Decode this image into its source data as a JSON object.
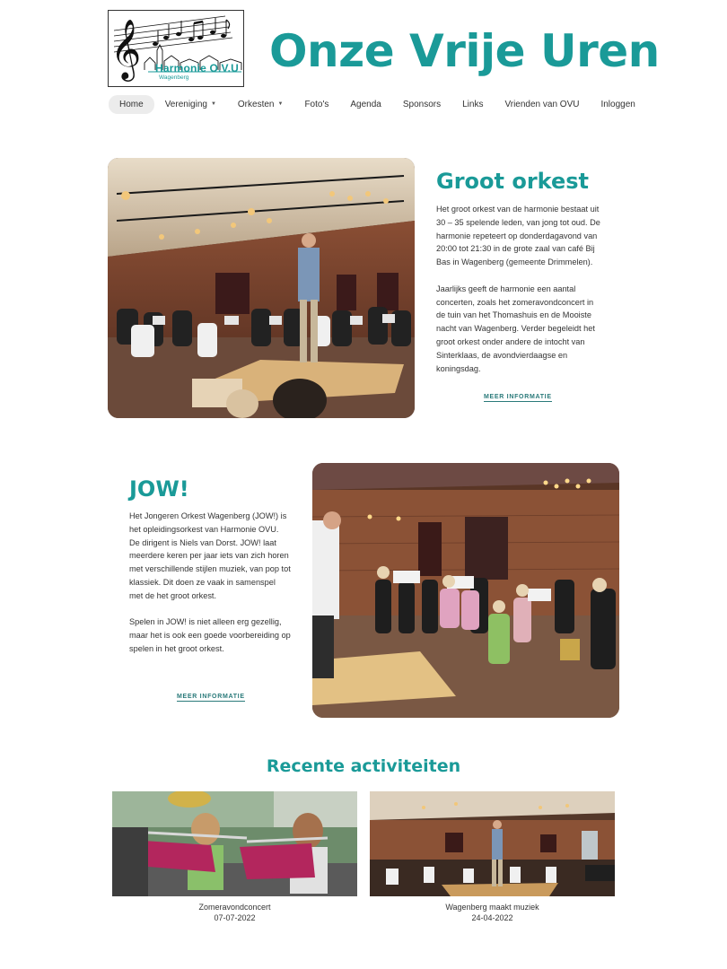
{
  "header": {
    "logo_title": "Harmonie O.V.U",
    "logo_subtitle": "Wagenberg",
    "site_title": "Onze Vrije Uren"
  },
  "nav": {
    "items": [
      {
        "label": "Home",
        "active": true,
        "has_dropdown": false
      },
      {
        "label": "Vereniging",
        "active": false,
        "has_dropdown": true
      },
      {
        "label": "Orkesten",
        "active": false,
        "has_dropdown": true
      },
      {
        "label": "Foto's",
        "active": false,
        "has_dropdown": false
      },
      {
        "label": "Agenda",
        "active": false,
        "has_dropdown": false
      },
      {
        "label": "Sponsors",
        "active": false,
        "has_dropdown": false
      },
      {
        "label": "Links",
        "active": false,
        "has_dropdown": false
      },
      {
        "label": "Vrienden van OVU",
        "active": false,
        "has_dropdown": false
      },
      {
        "label": "Inloggen",
        "active": false,
        "has_dropdown": false
      }
    ]
  },
  "groot_orkest": {
    "heading": "Groot orkest",
    "paragraph1": "Het groot orkest van de harmonie bestaat uit 30 – 35 spelende leden, van jong tot oud. De harmonie repeteert op donderdagavond van 20:00 tot 21:30 in de grote zaal van café Bij Bas in Wagenberg (gemeente Drimmelen).",
    "paragraph2": "Jaarlijks geeft de harmonie een aantal concerten, zoals het zomeravondconcert in de tuin van het Thomashuis en de Mooiste nacht van Wagenberg. Verder begeleidt het groot orkest onder andere de intocht van Sinterklaas, de avondvierdaagse en koningsdag.",
    "link": "MEER INFORMATIE"
  },
  "jow": {
    "heading": "JOW!",
    "paragraph1": "Het Jongeren Orkest Wagenberg (JOW!) is het opleidingsorkest van Harmonie OVU. De dirigent is Niels van Dorst. JOW! laat meerdere keren per jaar iets van zich horen met verschillende stijlen muziek, van pop tot klassiek. Dit doen ze vaak in samenspel met de het groot orkest.",
    "paragraph2": "Spelen in JOW! is niet alleen erg gezellig, maar het is ook een goede voorbereiding op spelen in het groot orkest.",
    "link": "MEER INFORMATIE"
  },
  "recent": {
    "heading": "Recente activiteiten",
    "cards": [
      {
        "title": "Zomeravondconcert",
        "date": "07-07-2022"
      },
      {
        "title": "Wagenberg maakt muziek",
        "date": "24-04-2022"
      }
    ]
  },
  "colors": {
    "accent": "#1a9a98",
    "text": "#333333",
    "link": "#2a7a7a"
  }
}
